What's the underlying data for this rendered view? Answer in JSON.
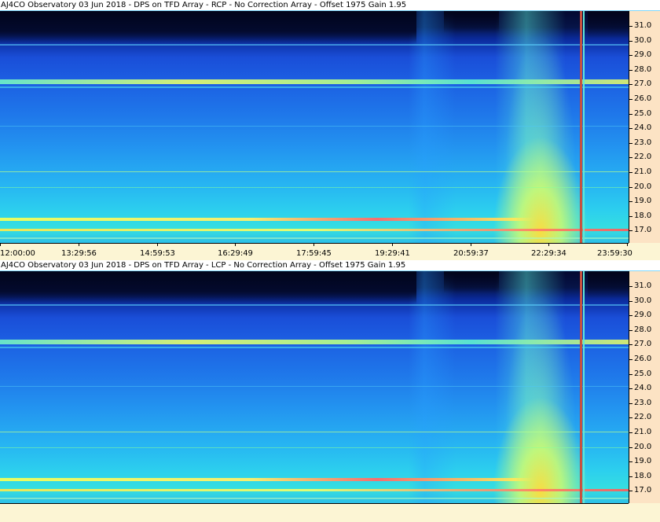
{
  "panels": [
    {
      "id": "rcp",
      "title": "AJ4CO Observatory 03 Jun 2018 - DPS on TFD Array  - RCP  -  No Correction Array  -  Offset 1975  Gain 1.95",
      "freq_labels": [
        "31.0",
        "30.0",
        "29.0",
        "28.0",
        "27.0",
        "26.0",
        "25.0",
        "24.0",
        "23.0",
        "22.0",
        "21.0",
        "20.0",
        "19.0",
        "18.0",
        "17.0"
      ],
      "time_labels": [
        "12:00:00",
        "13:29:56",
        "14:59:53",
        "16:29:49",
        "17:59:45",
        "19:29:41",
        "20:59:37",
        "22:29:34",
        "23:59:30"
      ]
    },
    {
      "id": "lcp",
      "title": "AJ4CO Observatory 03 Jun 2018 - DPS on TFD Array  - LCP  -  No Correction Array  -  Offset 1975  Gain 1.95",
      "freq_labels": [
        "31.0",
        "30.0",
        "29.0",
        "28.0",
        "27.0",
        "26.0",
        "25.0",
        "24.0",
        "23.0",
        "22.0",
        "21.0",
        "20.0",
        "19.0",
        "18.0",
        "17.0"
      ],
      "time_labels": []
    }
  ],
  "colors": {
    "title_bg": "#ffffff",
    "axis_bg": "#fce3c4",
    "page_bg": "#fcf5d4",
    "marker_red": "#a01020",
    "marker_cyan": "#5fe8d8"
  }
}
